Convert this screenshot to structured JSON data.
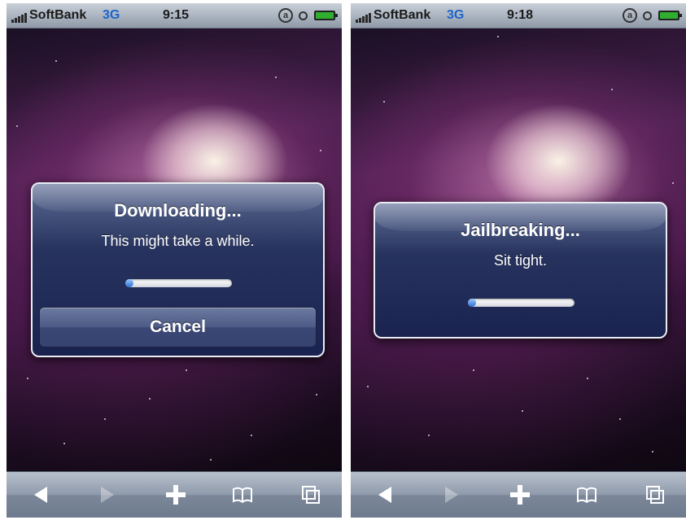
{
  "left_screen": {
    "status_bar": {
      "carrier": "SoftBank",
      "network": "3G",
      "time": "9:15"
    },
    "alert": {
      "title": "Downloading...",
      "message": "This might take a while.",
      "progress": 0.08,
      "cancel_label": "Cancel"
    },
    "toolbar": {
      "back_icon": "back-arrow-icon",
      "forward_icon": "forward-arrow-icon",
      "add_icon": "plus-icon",
      "bookmarks_icon": "book-icon",
      "pages_icon": "pages-icon"
    }
  },
  "right_screen": {
    "status_bar": {
      "carrier": "SoftBank",
      "network": "3G",
      "time": "9:18"
    },
    "alert": {
      "title": "Jailbreaking...",
      "message": "Sit tight.",
      "progress": 0.08
    },
    "toolbar": {
      "back_icon": "back-arrow-icon",
      "forward_icon": "forward-arrow-icon",
      "add_icon": "plus-icon",
      "bookmarks_icon": "book-icon",
      "pages_icon": "pages-icon"
    }
  },
  "colors": {
    "network_blue": "#1c64c8",
    "alert_blue": "#27335e",
    "progress_blue": "#2a6fd6",
    "battery_green": "#2fae2f"
  }
}
